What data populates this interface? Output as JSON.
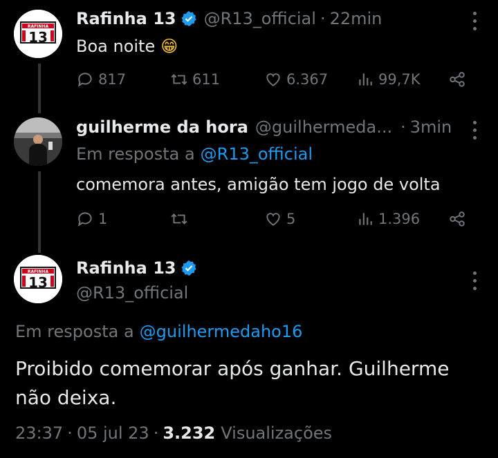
{
  "tweet1": {
    "author_name": "Rafinha 13",
    "handle": "@R13_official",
    "separator": "·",
    "time": "22min",
    "text": "Boa noite",
    "emoji": "😁",
    "avatar_logo_text": "RAFINHA",
    "avatar_number": "13",
    "actions": {
      "replies": "817",
      "retweets": "611",
      "likes": "6.367",
      "views": "99,7K"
    }
  },
  "tweet2": {
    "author_name": "guilherme da hora",
    "handle": "@guilhermeda...",
    "separator": "·",
    "time": "3min",
    "reply_prefix": "Em resposta a",
    "reply_to": "@R13_official",
    "text": "comemora antes, amigão tem jogo de volta",
    "actions": {
      "replies": "1",
      "retweets": "",
      "likes": "5",
      "views": "1.396"
    }
  },
  "tweet3": {
    "author_name": "Rafinha 13",
    "handle": "@R13_official",
    "avatar_logo_text": "RAFINHA",
    "avatar_number": "13",
    "reply_prefix": "Em resposta a",
    "reply_to": "@guilhermedaho16",
    "text_line1": "Proibido comemorar após ganhar. Guilherme",
    "text_line2": "não deixa.",
    "time": "23:37",
    "sep1": "·",
    "date": "05 jul 23",
    "sep2": "·",
    "views_count": "3.232",
    "views_label": "Visualizações"
  },
  "colors": {
    "background": "#000000",
    "text": "#e7e9ea",
    "muted": "#71767b",
    "accent": "#1d9bf0",
    "logo_red": "#d0021b"
  },
  "icons": [
    "verified-badge-icon",
    "reply-icon",
    "retweet-icon",
    "like-icon",
    "views-icon",
    "share-icon",
    "more-icon"
  ]
}
